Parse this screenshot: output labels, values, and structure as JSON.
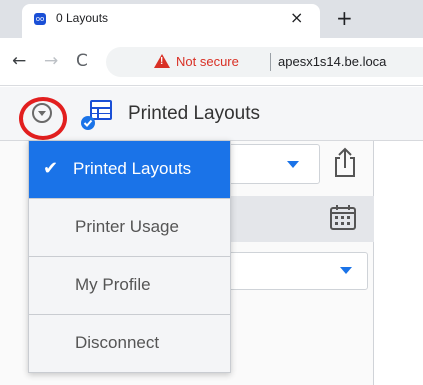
{
  "browser": {
    "tab_title": "0 Layouts",
    "tab_favicon_text": "oo",
    "tab_close": "×",
    "new_tab": "+",
    "back": "←",
    "forward": "→",
    "reload": "C",
    "not_secure_label": "Not secure",
    "url": "apesx1s14.be.loca"
  },
  "app": {
    "title": "Printed Layouts",
    "menu": [
      {
        "label": "Printed Layouts",
        "active": true
      },
      {
        "label": "Printer Usage",
        "active": false
      },
      {
        "label": "My Profile",
        "active": false
      },
      {
        "label": "Disconnect",
        "active": false
      }
    ]
  },
  "colors": {
    "accent": "#1a73e8",
    "highlight_ring": "#e21f1f",
    "warning": "#d93025"
  },
  "icons": {
    "menu_toggle": "chevron-down-circle-icon",
    "app_logo": "layouts-grid-icon",
    "check": "checkmark-icon",
    "export": "export-icon",
    "calendar": "calendar-icon"
  }
}
